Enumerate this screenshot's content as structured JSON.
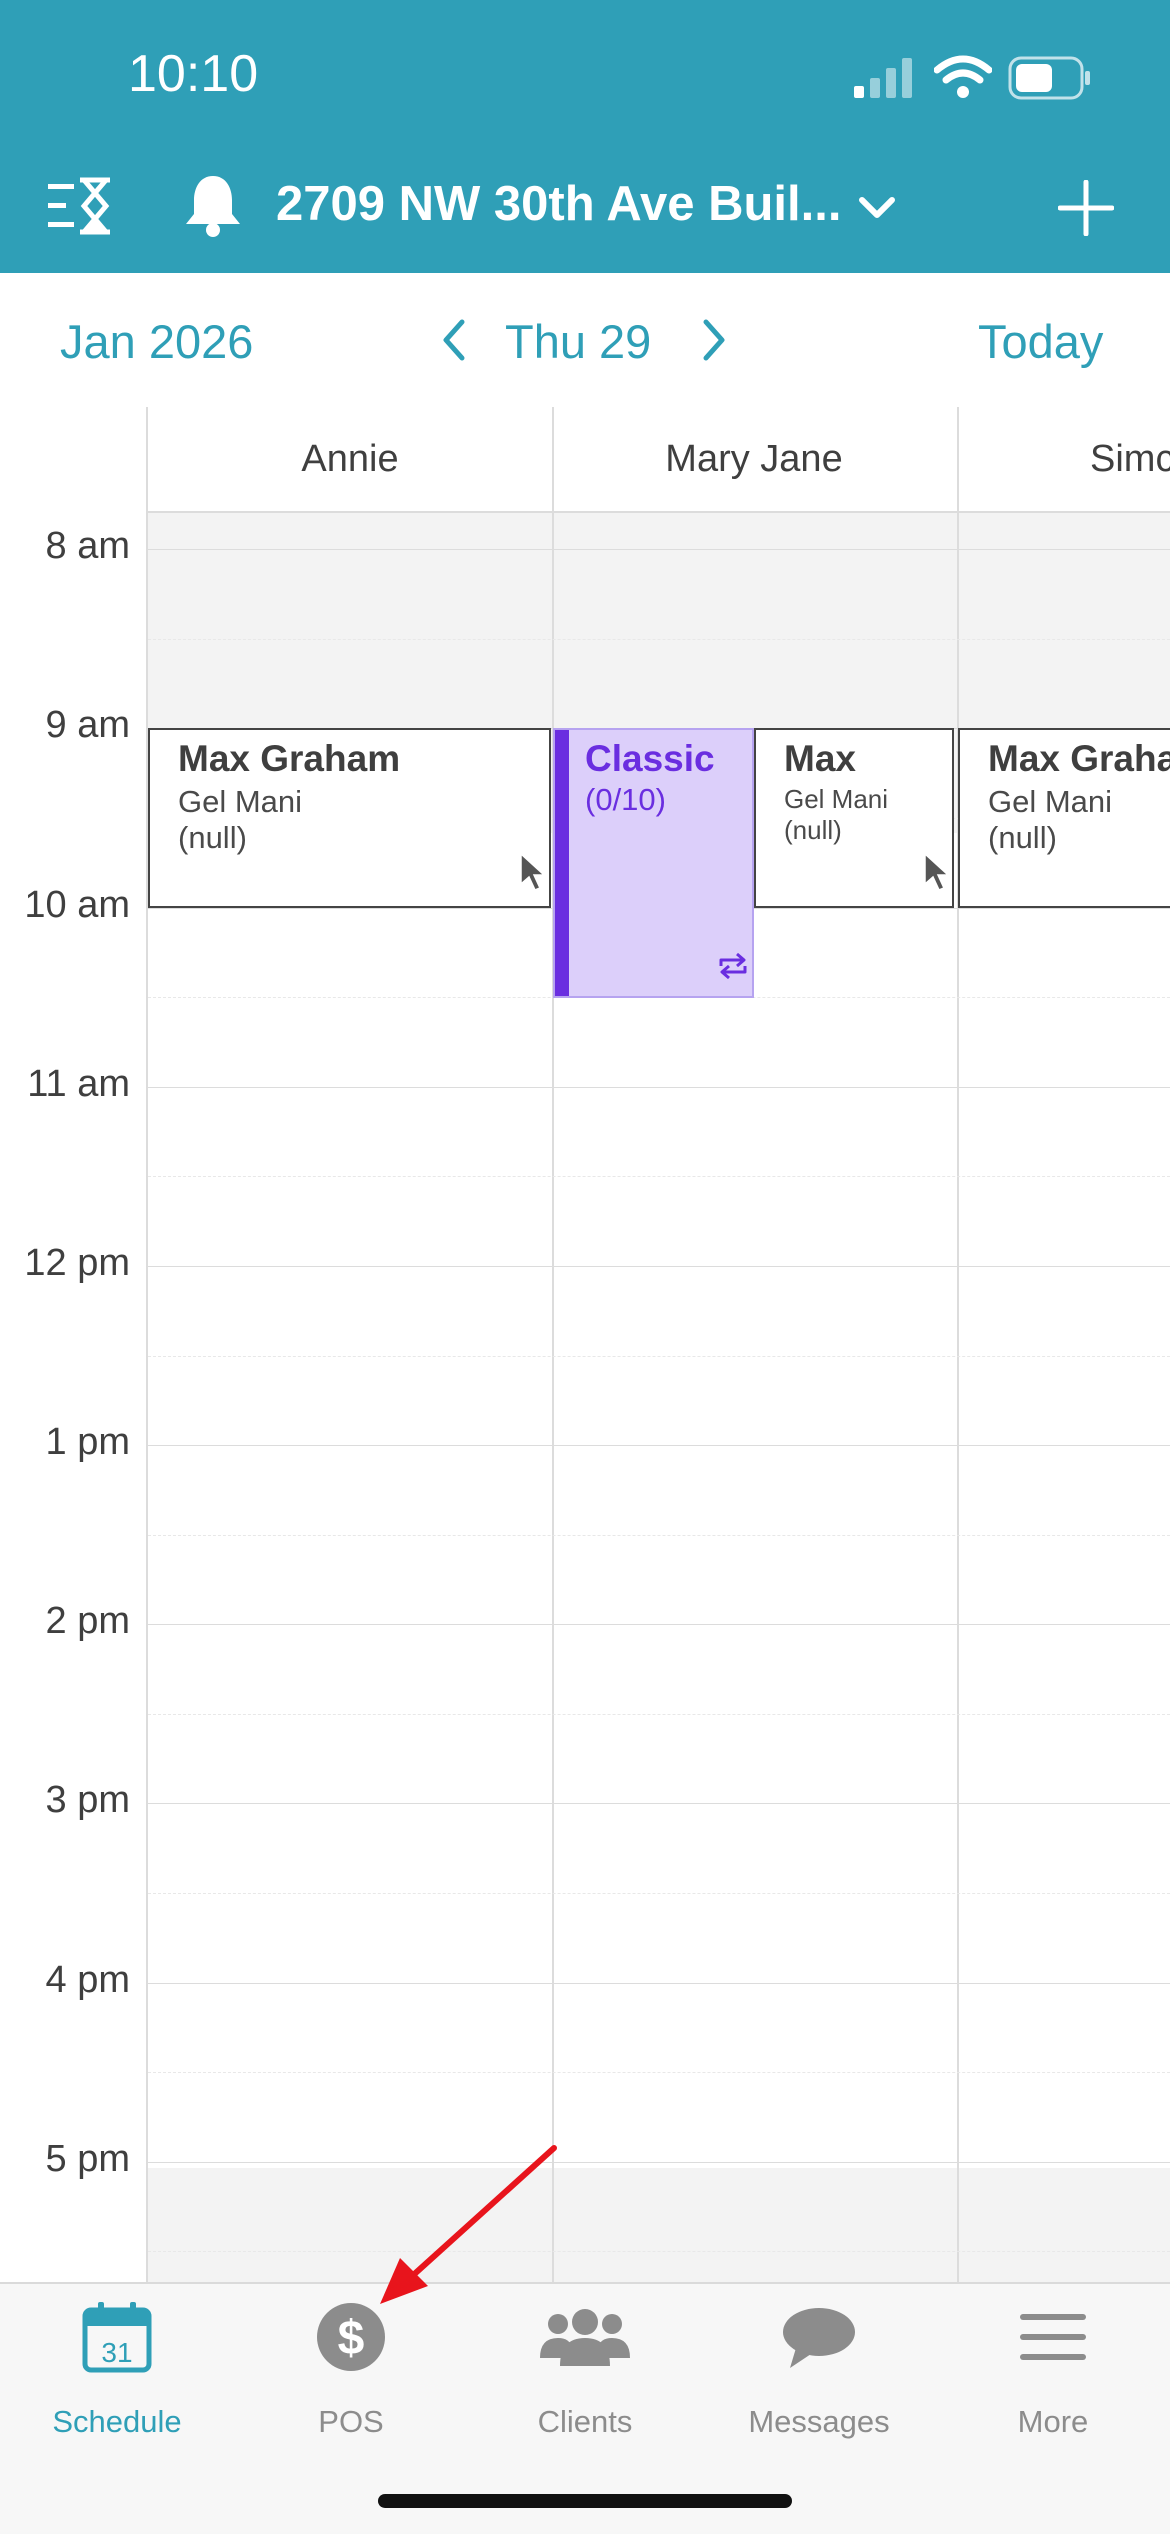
{
  "status_bar": {
    "time": "10:10"
  },
  "header": {
    "location_title": "2709 NW 30th Ave Buil...",
    "icons": [
      "list-timer-icon",
      "bell-icon",
      "chevron-down-icon",
      "plus-icon"
    ]
  },
  "date_nav": {
    "month": "Jan 2026",
    "day": "Thu 29",
    "today_label": "Today"
  },
  "staff": [
    {
      "name": "Annie"
    },
    {
      "name": "Mary Jane"
    },
    {
      "name": "Simc"
    }
  ],
  "time_labels": [
    "8 am",
    "9 am",
    "10 am",
    "11 am",
    "12 pm",
    "1 pm",
    "2 pm",
    "3 pm",
    "4 pm",
    "5 pm"
  ],
  "appointments": [
    {
      "client": "Max Graham",
      "service": "Gel Mani",
      "note": "(null)"
    },
    {
      "client": "Max",
      "service": "Gel Mani",
      "note": "(null)"
    },
    {
      "client": "Max Graha",
      "service": "Gel Mani",
      "note": "(null)"
    }
  ],
  "class_event": {
    "name": "Classic",
    "capacity": "(0/10)",
    "color": "#6a2ee0"
  },
  "tabs": [
    {
      "label": "Schedule",
      "icon": "calendar-icon",
      "active": true,
      "calendar_day": "31"
    },
    {
      "label": "POS",
      "icon": "dollar-icon",
      "active": false
    },
    {
      "label": "Clients",
      "icon": "people-icon",
      "active": false
    },
    {
      "label": "Messages",
      "icon": "chat-bubble-icon",
      "active": false
    },
    {
      "label": "More",
      "icon": "menu-icon",
      "active": false
    }
  ],
  "colors": {
    "brand": "#2f9fb7",
    "class_purple": "#6a2ee0",
    "annotation_arrow": "#e8141c"
  }
}
